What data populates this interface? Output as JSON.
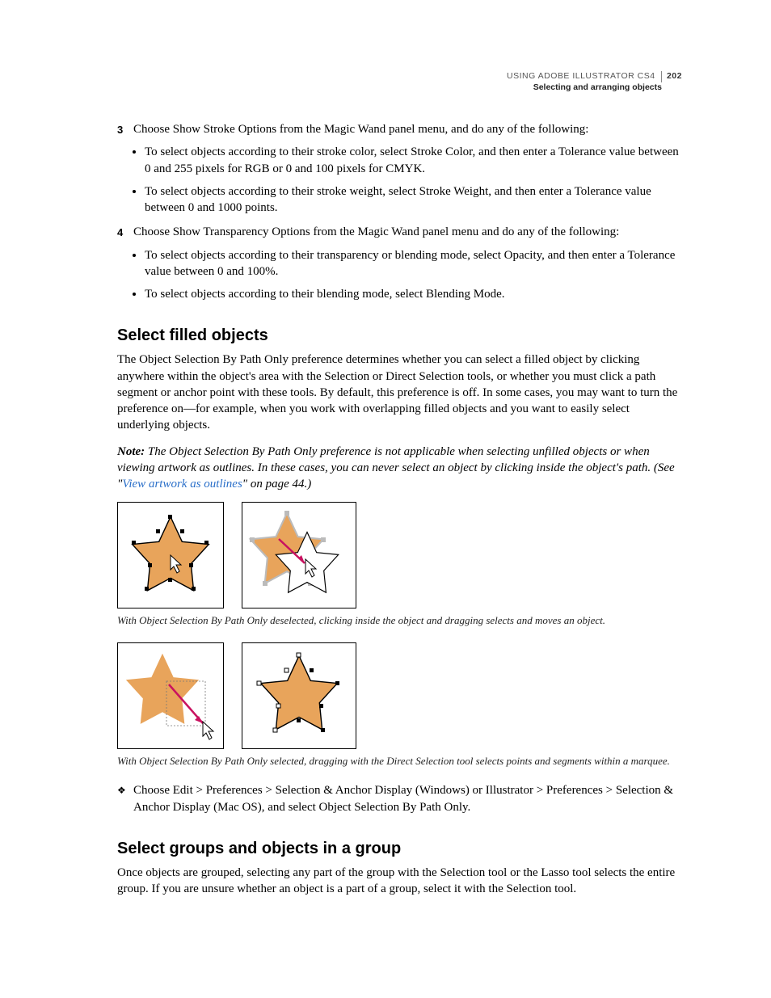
{
  "header": {
    "book": "USING ADOBE ILLUSTRATOR CS4",
    "section": "Selecting and arranging objects",
    "page": "202"
  },
  "steps": {
    "s3": {
      "num": "3",
      "text": "Choose Show Stroke Options from the Magic Wand panel menu, and do any of the following:",
      "bullets": [
        "To select objects according to their stroke color, select Stroke Color, and then enter a Tolerance value between 0 and 255 pixels for RGB or 0 and 100 pixels for CMYK.",
        "To select objects according to their stroke weight, select Stroke Weight, and then enter a Tolerance value between 0 and 1000 points."
      ]
    },
    "s4": {
      "num": "4",
      "text": "Choose Show Transparency Options from the Magic Wand panel menu and do any of the following:",
      "bullets": [
        "To select objects according to their transparency or blending mode, select Opacity, and then enter a Tolerance value between 0 and 100%.",
        "To select objects according to their blending mode, select Blending Mode."
      ]
    }
  },
  "h_fill": "Select filled objects",
  "p_fill": "The Object Selection By Path Only preference determines whether you can select a filled object by clicking anywhere within the object's area with the Selection or Direct Selection tools, or whether you must click a path segment or anchor point with these tools. By default, this preference is off. In some cases, you may want to turn the preference on—for example, when you work with overlapping filled objects and you want to easily select underlying objects.",
  "note": {
    "label": "Note:",
    "before": " The Object Selection By Path Only preference is not applicable when selecting unfilled objects or when viewing artwork as outlines. In these cases, you can never select an object by clicking inside the object's path. (See \"",
    "link": "View artwork as outlines",
    "after": "\" on page 44.)"
  },
  "caption1": "With Object Selection By Path Only deselected, clicking inside the object and dragging selects and moves an object.",
  "caption2": "With Object Selection By Path Only selected, dragging with the Direct Selection tool selects points and segments within a marquee.",
  "diamond": "Choose Edit > Preferences > Selection & Anchor Display (Windows) or Illustrator > Preferences > Selection & Anchor Display (Mac OS), and select Object Selection By Path Only.",
  "h_groups": "Select groups and objects in a group",
  "p_groups": "Once objects are grouped, selecting any part of the group with the Selection tool or the Lasso tool selects the entire group. If you are unsure whether an object is a part of a group, select it with the Selection tool."
}
